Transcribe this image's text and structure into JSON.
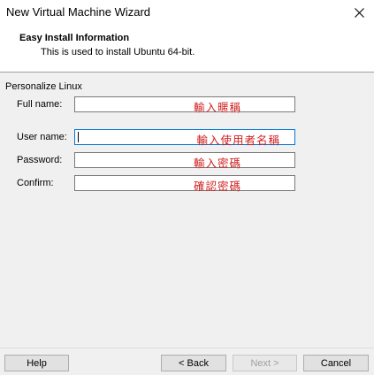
{
  "window": {
    "title": "New Virtual Machine Wizard",
    "close_icon": "close-icon"
  },
  "header": {
    "title": "Easy Install Information",
    "subtitle": "This is used to install Ubuntu 64-bit."
  },
  "section": {
    "label": "Personalize Linux"
  },
  "fields": {
    "full_name": {
      "label": "Full name:",
      "hint": "輸入暱稱"
    },
    "user_name": {
      "label": "User name:",
      "hint": "輸入使用者名稱"
    },
    "password": {
      "label": "Password:",
      "hint": "輸入密碼"
    },
    "confirm": {
      "label": "Confirm:",
      "hint": "確認密碼"
    }
  },
  "buttons": {
    "help": "Help",
    "back": "< Back",
    "next": "Next >",
    "cancel": "Cancel"
  },
  "colors": {
    "hint_text": "#d02020",
    "focus_border": "#0078d7"
  }
}
